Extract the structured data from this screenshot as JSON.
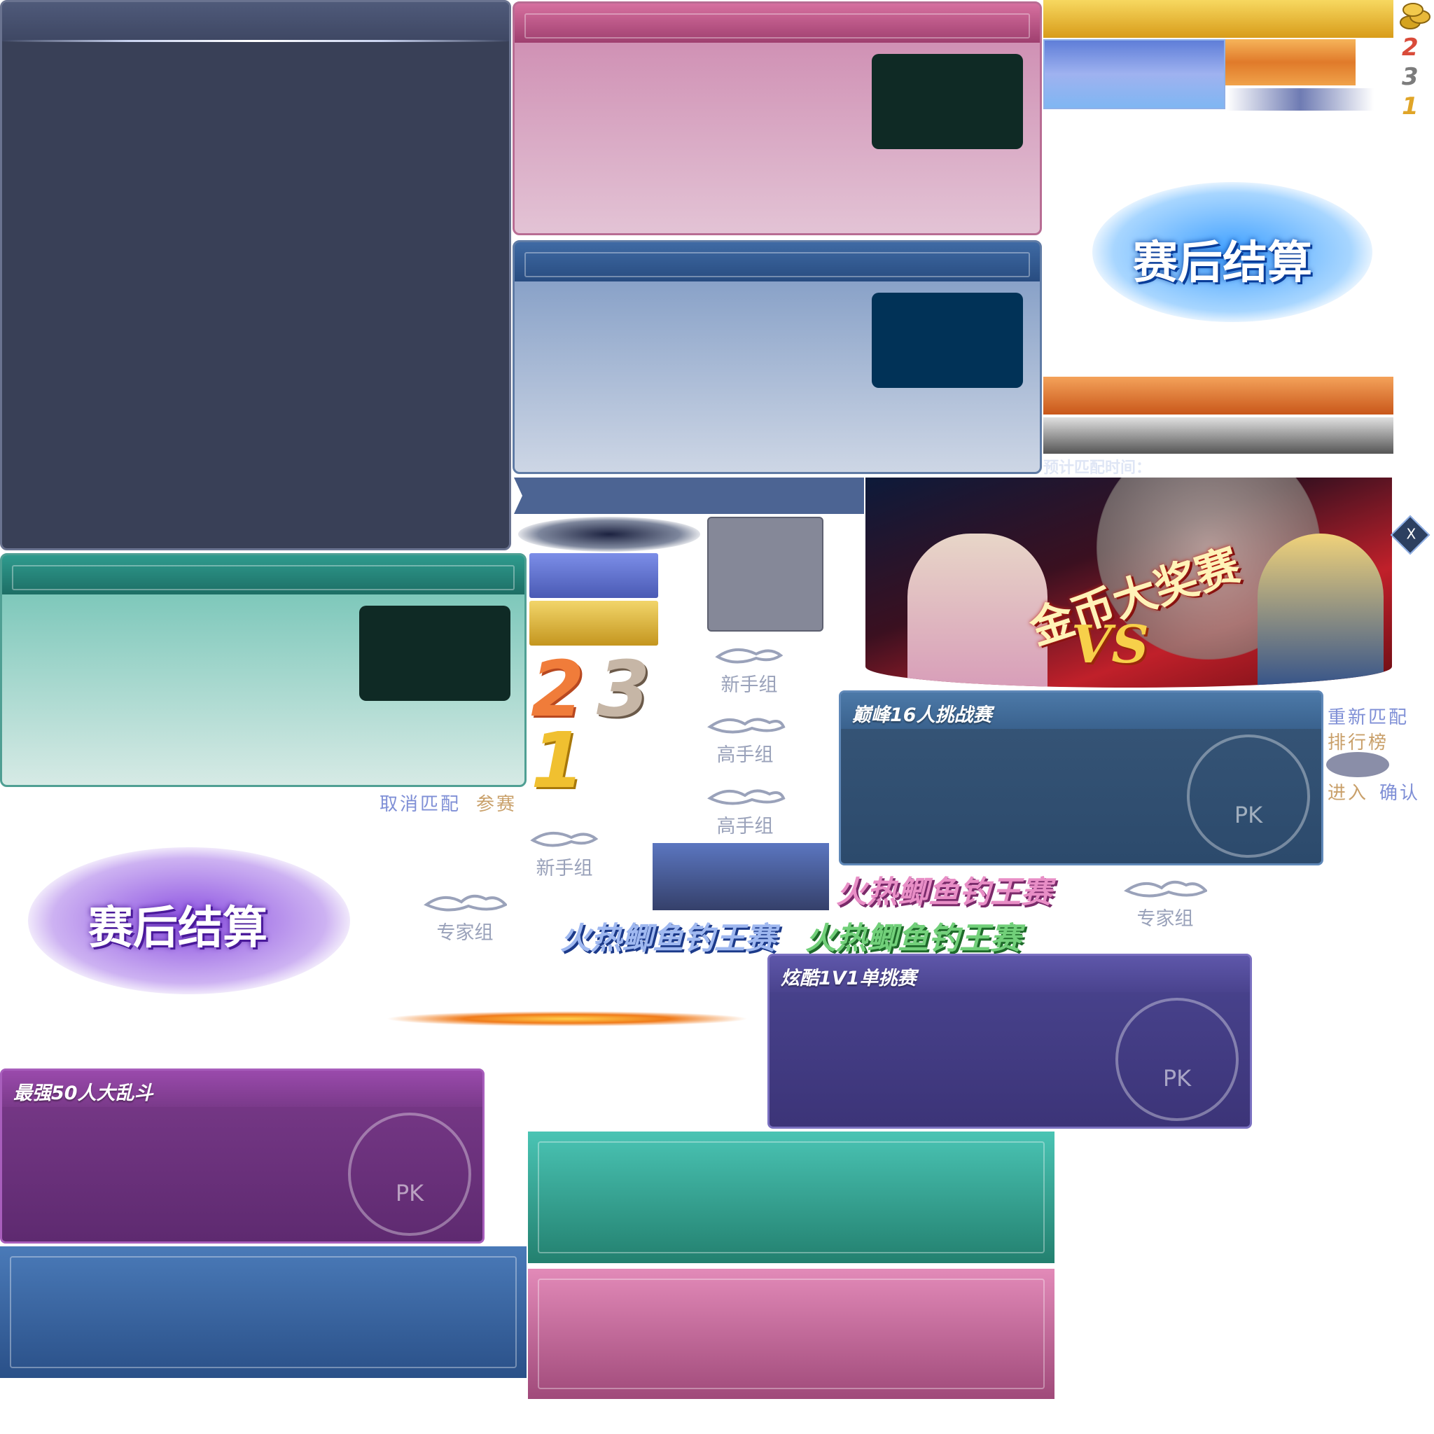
{
  "panels": {
    "large_navy": {},
    "pink": {},
    "blue": {},
    "teal": {}
  },
  "result_logo": {
    "blue_text": "赛后结算",
    "purple_text": "赛后结算"
  },
  "labels": {
    "estimated_match_time": "预计匹配时间：",
    "cancel_match": "取消匹配",
    "join": "参赛",
    "rematch": "重新匹配",
    "leaderboard": "排行榜",
    "enter": "进入",
    "confirm": "确认",
    "close": "X"
  },
  "ranks": {
    "small": [
      "2",
      "3",
      "1"
    ],
    "large_2": "2",
    "large_3": "3",
    "large_1": "1"
  },
  "groups": {
    "novice_1": "新手组",
    "expert_1": "高手组",
    "expert_2": "高手组",
    "novice_2": "新手组",
    "master_1": "专家组",
    "master_2": "专家组"
  },
  "banner": {
    "title": "金币大奖赛",
    "vs": "VS"
  },
  "cards": {
    "peak16": {
      "title": "巅峰16人挑战赛",
      "badge": "PK"
    },
    "cool1v1": {
      "title": "炫酷1V1单挑赛",
      "badge": "PK"
    },
    "brawl50": {
      "title": "最强50人大乱斗",
      "badge": "PK"
    }
  },
  "event_titles": {
    "pink": "火热鲫鱼钓王赛",
    "blue": "火热鲫鱼钓王赛",
    "green": "火热鲫鱼钓王赛"
  },
  "colors": {
    "navy": "#394057",
    "pink": "#cc87ae",
    "blue": "#7b97c2",
    "teal": "#6cc1b2",
    "gold": "#e8b83a",
    "orange": "#e07a2a"
  }
}
